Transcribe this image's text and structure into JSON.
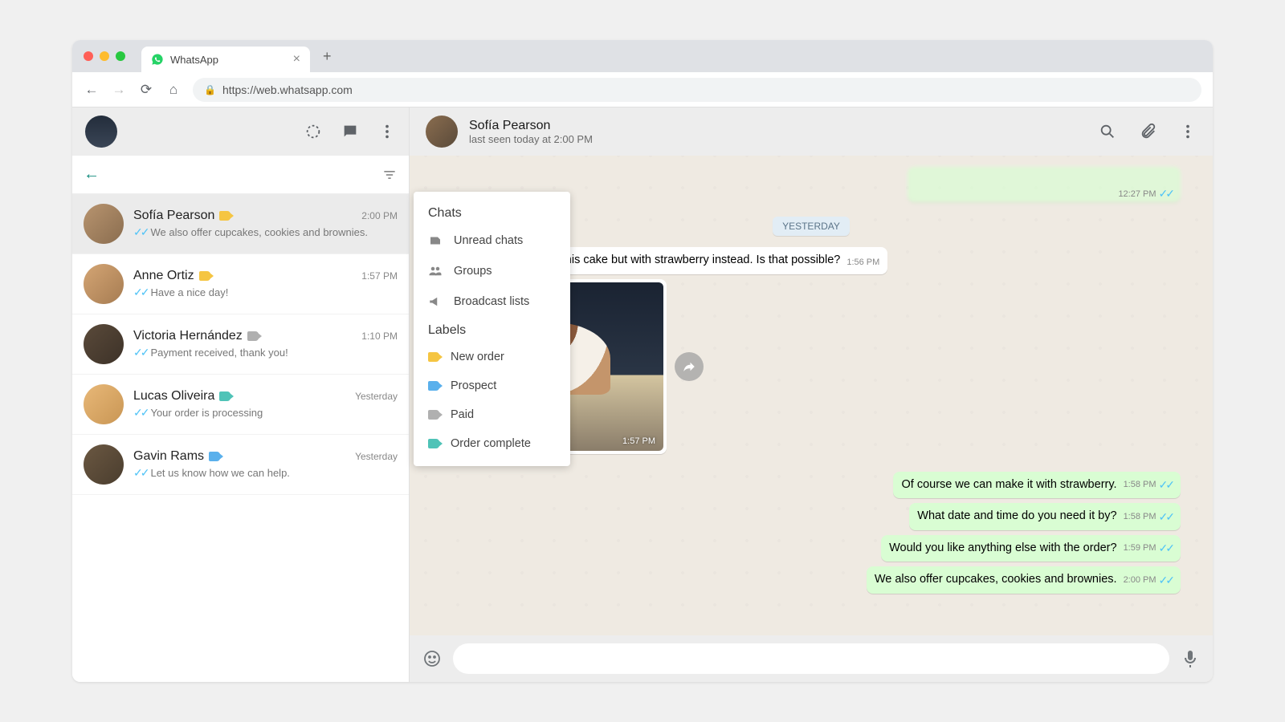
{
  "browser": {
    "tab_title": "WhatsApp",
    "url": "https://web.whatsapp.com"
  },
  "sidebar": {
    "chats": [
      {
        "name": "Sofía Pearson",
        "time": "2:00 PM",
        "preview": "We also offer cupcakes, cookies and brownies.",
        "label": "yellow",
        "active": true
      },
      {
        "name": "Anne Ortiz",
        "time": "1:57 PM",
        "preview": "Have a nice day!",
        "label": "yellow",
        "active": false
      },
      {
        "name": "Victoria Hernández",
        "time": "1:10 PM",
        "preview": "Payment received, thank you!",
        "label": "gray",
        "active": false
      },
      {
        "name": "Lucas Oliveira",
        "time": "Yesterday",
        "preview": "Your order is processing",
        "label": "teal",
        "active": false
      },
      {
        "name": "Gavin Rams",
        "time": "Yesterday",
        "preview": "Let us know how we can help.",
        "label": "blue",
        "active": false
      }
    ]
  },
  "dropdown": {
    "title1": "Chats",
    "items1": [
      {
        "icon": "speaker",
        "label": "Unread chats"
      },
      {
        "icon": "group",
        "label": "Groups"
      },
      {
        "icon": "megaphone",
        "label": "Broadcast lists"
      }
    ],
    "title2": "Labels",
    "items2": [
      {
        "color": "yellow",
        "label": "New order"
      },
      {
        "color": "blue",
        "label": "Prospect"
      },
      {
        "color": "gray",
        "label": "Paid"
      },
      {
        "color": "teal",
        "label": "Order complete"
      }
    ]
  },
  "conversation": {
    "header": {
      "name": "Sofía Pearson",
      "status": "last seen today at 2:00 PM"
    },
    "date_divider": "YESTERDAY",
    "prev_out_time": "12:27 PM",
    "messages": [
      {
        "dir": "in",
        "text": "Hello, I'd like to order this cake but with strawberry instead. Is that possible?",
        "time": "1:56 PM"
      }
    ],
    "image_time": "1:57 PM",
    "out_messages": [
      {
        "text": "Of course we can make it with strawberry.",
        "time": "1:58 PM"
      },
      {
        "text": "What date and time do you need it by?",
        "time": "1:58 PM"
      },
      {
        "text": "Would you like anything else with the order?",
        "time": "1:59 PM"
      },
      {
        "text": "We also offer cupcakes, cookies and brownies.",
        "time": "2:00 PM"
      }
    ]
  }
}
